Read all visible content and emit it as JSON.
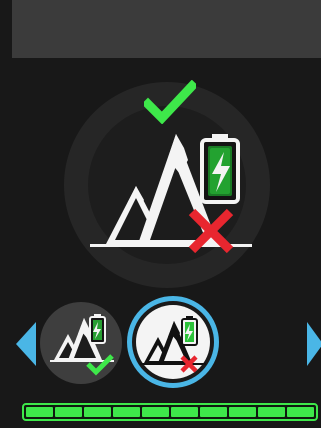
{
  "colors": {
    "accent": "#3ee84a",
    "selection": "#4ab6e6",
    "error": "#e8262f",
    "nav_arrow": "#4ab6e6"
  },
  "icons": {
    "main": [
      "check-icon",
      "mountain-icon",
      "battery-charging-icon",
      "cross-icon"
    ],
    "thumb_1": [
      "mountain-icon",
      "battery-charging-icon",
      "check-icon"
    ],
    "thumb_2": [
      "mountain-icon",
      "battery-charging-icon",
      "cross-icon"
    ],
    "navigation": [
      "previous-arrow-icon",
      "next-arrow-icon"
    ]
  },
  "options": [
    {
      "state": "check",
      "selected": false
    },
    {
      "state": "cross",
      "selected": true
    }
  ],
  "progress": {
    "segments_total": 10,
    "segments_filled": 10,
    "fraction": 1.0
  }
}
